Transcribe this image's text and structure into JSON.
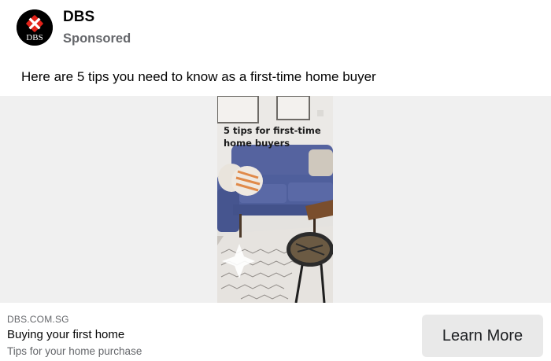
{
  "post": {
    "advertiser": "DBS",
    "sponsored_label": "Sponsored",
    "logo_text": "DBS",
    "message": "Here are 5 tips you need to know as a first-time home buyer"
  },
  "media": {
    "caption_line1": "5 tips for first-time",
    "caption_line2": "home buyers"
  },
  "link": {
    "domain": "DBS.COM.SG",
    "headline": "Buying your first home",
    "description": "Tips for your home purchase",
    "cta_label": "Learn More"
  },
  "colors": {
    "brand_red": "#e2231a",
    "sofa_blue": "#4f5f9c",
    "secondary_text": "#65676b",
    "cta_bg": "#e9e9e9"
  }
}
